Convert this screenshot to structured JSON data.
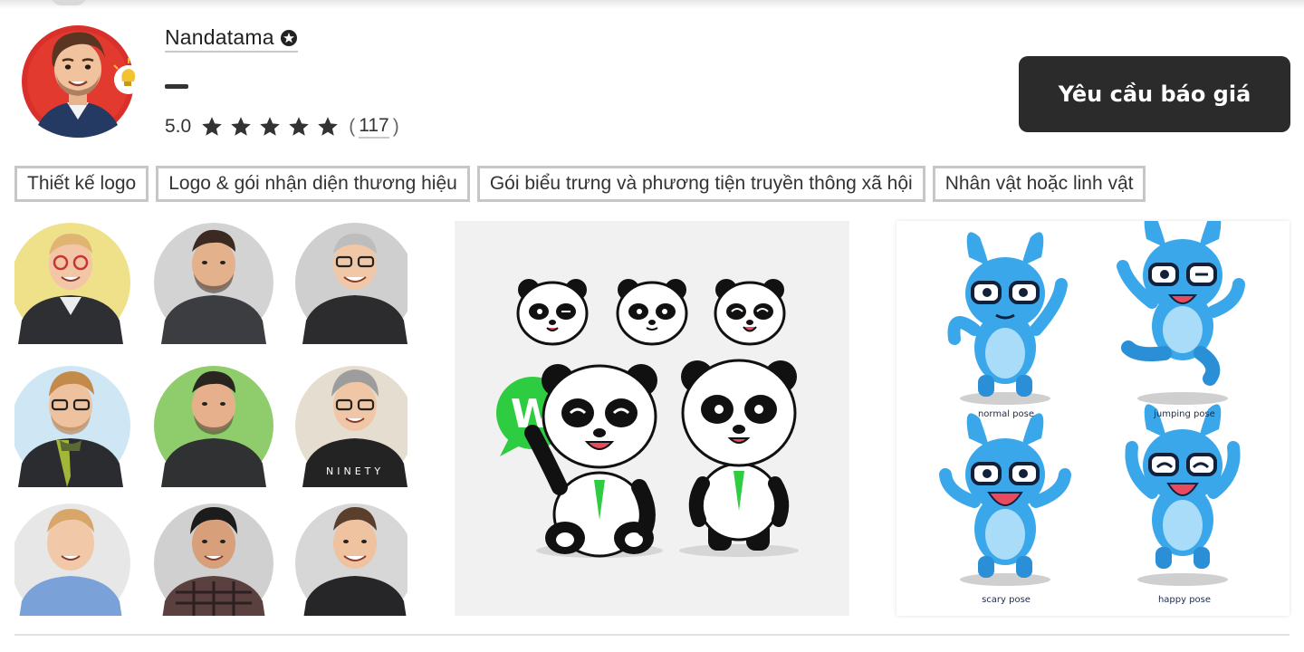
{
  "designer": {
    "name": "Nandatama",
    "rating_value": "5.0",
    "stars": 5,
    "review_count": "117",
    "paren_open": "(",
    "paren_close": ")"
  },
  "actions": {
    "quote_label": "Yêu cầu báo giá"
  },
  "tags": [
    "Thiết kế logo",
    "Logo & gói nhận diện thương hiệu",
    "Gói biểu trưng và phương tiện truyền thông xã hội",
    "Nhân vật hoặc linh vật"
  ],
  "portfolio": {
    "card_3": {
      "pose_labels": [
        "normal pose",
        "jumping pose",
        "scary pose",
        "happy pose"
      ],
      "badge_letter": "W"
    },
    "card_2": {
      "badge_letter": "W"
    },
    "card_1": {
      "shirt_text": "NINETY"
    }
  },
  "colors": {
    "button_bg": "#2b2b2b",
    "avatar_ring": "#d92d20",
    "mascot_blue": "#3aa7ea",
    "panda_green": "#2ecc40"
  }
}
